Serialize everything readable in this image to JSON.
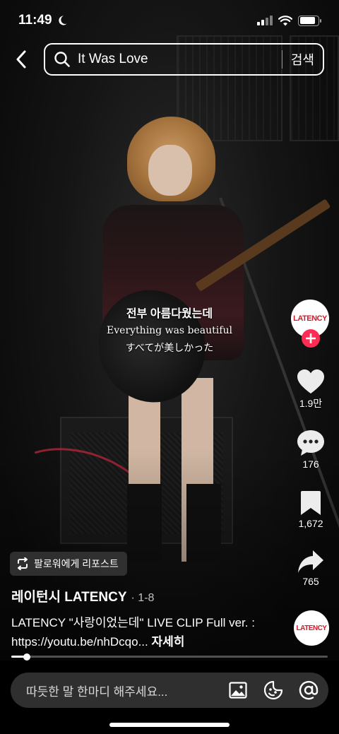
{
  "status_bar": {
    "time": "11:49",
    "battery_level": 0.85
  },
  "search": {
    "query": "It Was Love",
    "button_label": "검색"
  },
  "subtitles": {
    "korean": "전부 아름다웠는데",
    "english": "Everything was beautiful",
    "japanese": "すべてが美しかった"
  },
  "creator": {
    "avatar_text": "LATENCY",
    "name": "레이턴시 LATENCY",
    "series": "· 1-8"
  },
  "actions": {
    "likes": "1.9만",
    "comments": "176",
    "saves": "1,672",
    "shares": "765"
  },
  "repost_label": "팔로워에게 리포스트",
  "caption": {
    "text": "LATENCY \"사랑이었는데\" LIVE CLIP Full ver. : https://youtu.be/nhDcqo...",
    "more": "자세히"
  },
  "progress": 0.05,
  "sound_disc_text": "LATENCY",
  "comment": {
    "placeholder": "따듯한 말 한마디 해주세요..."
  },
  "colors": {
    "accent_red": "#fe2c55",
    "brand_red": "#d31a2a"
  },
  "icons": [
    "moon-icon",
    "signal-icon",
    "wifi-icon",
    "battery-icon",
    "back-arrow-icon",
    "search-icon",
    "plus-icon",
    "heart-icon",
    "comment-icon",
    "bookmark-icon",
    "share-icon",
    "repost-icon",
    "image-icon",
    "emoji-icon",
    "mention-icon"
  ]
}
